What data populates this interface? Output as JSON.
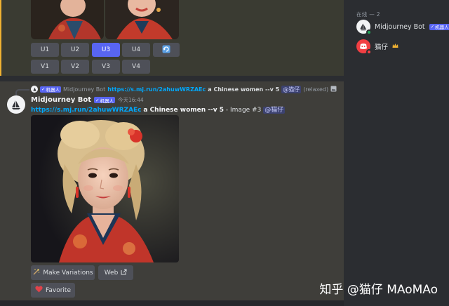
{
  "top_buttons": {
    "upscale": [
      "U1",
      "U2",
      "U3",
      "U4"
    ],
    "variation": [
      "V1",
      "V2",
      "V3",
      "V4"
    ],
    "selected": "U3",
    "reroll_icon": "refresh-icon"
  },
  "reply": {
    "bot_tag": "机器人",
    "username": "Midjourney Bot",
    "link": "https://s.mj.run/2ahuwWRZAEc",
    "prompt": "a Chinese women --v 5",
    "mention": "@猫仔",
    "mode": "(relaxed)"
  },
  "message": {
    "username": "Midjourney Bot",
    "bot_tag": "机器人",
    "timestamp": "今天16:44",
    "link": "https://s.mj.run/2ahuwWRZAEc",
    "prompt": "a Chinese women --v 5",
    "image_label": "- Image #3",
    "mention": "@猫仔"
  },
  "actions": {
    "make_variations": "Make Variations",
    "web": "Web",
    "favorite": "Favorite"
  },
  "sidebar": {
    "online_header": "在线 — 2",
    "members": [
      {
        "name": "Midjourney Bot",
        "tag": "机器人"
      },
      {
        "name": "猫仔",
        "badge": "crown-icon"
      }
    ]
  },
  "watermark": "知乎 @猫仔 MAoMAo",
  "colors": {
    "blurple": "#5865f2",
    "link": "#00a8fc",
    "online": "#23a55a",
    "dnd": "#f23f43",
    "crown": "#f0b232"
  }
}
